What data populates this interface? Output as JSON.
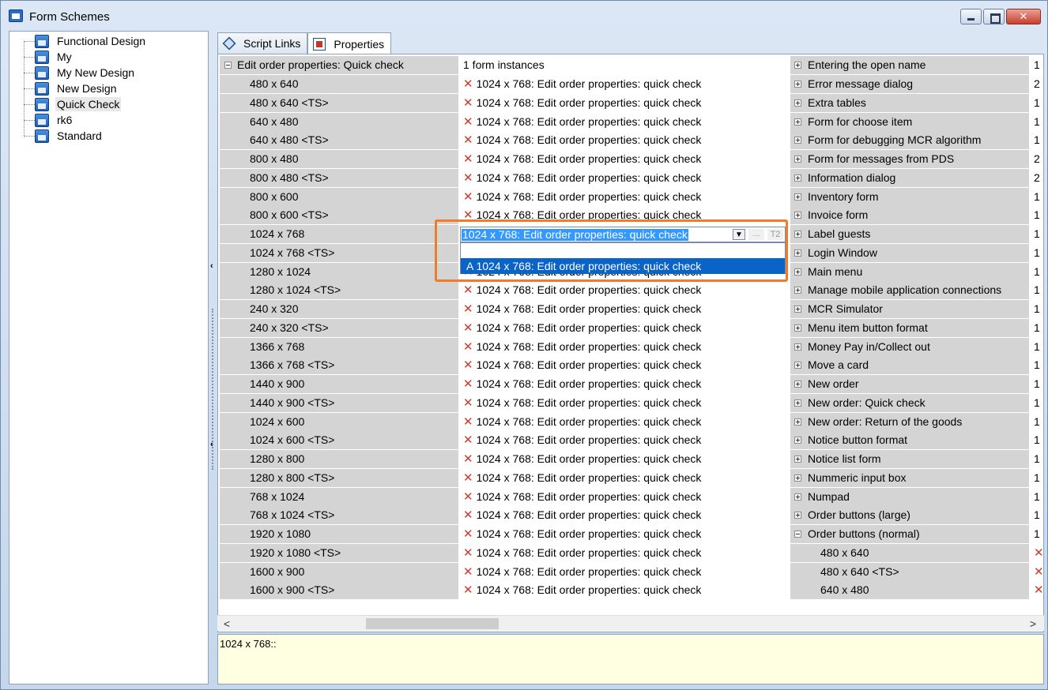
{
  "window": {
    "title": "Form Schemes"
  },
  "tree": {
    "items": [
      {
        "label": "Functional Design",
        "selected": false
      },
      {
        "label": "My",
        "selected": false
      },
      {
        "label": "My New Design",
        "selected": false
      },
      {
        "label": "New Design",
        "selected": false
      },
      {
        "label": "Quick Check",
        "selected": true
      },
      {
        "label": "rk6",
        "selected": false
      },
      {
        "label": "Standard",
        "selected": false
      }
    ]
  },
  "tabs": [
    {
      "label": "Script Links",
      "active": false,
      "icon": "script-links-icon"
    },
    {
      "label": "Properties",
      "active": true,
      "icon": "properties-icon"
    }
  ],
  "grid": {
    "header": {
      "c1": "Edit order properties: Quick check",
      "c2": "1 form instances",
      "c3": "Entering the open name",
      "c4": "1"
    },
    "rows": [
      {
        "c1": "480 x 640",
        "c2": "1024 x 768: Edit order properties: quick check",
        "c3": "Error message dialog",
        "c4": "2"
      },
      {
        "c1": "480 x 640 <TS>",
        "c2": "1024 x 768: Edit order properties: quick check",
        "c3": "Extra tables",
        "c4": "1"
      },
      {
        "c1": "640 x 480",
        "c2": "1024 x 768: Edit order properties: quick check",
        "c3": "Form for choose item",
        "c4": "1"
      },
      {
        "c1": "640 x 480 <TS>",
        "c2": "1024 x 768: Edit order properties: quick check",
        "c3": "Form for debugging MCR algorithm",
        "c4": "1"
      },
      {
        "c1": "800 x 480",
        "c2": "1024 x 768: Edit order properties: quick check",
        "c3": "Form for messages from PDS",
        "c4": "2"
      },
      {
        "c1": "800 x 480 <TS>",
        "c2": "1024 x 768: Edit order properties: quick check",
        "c3": "Information dialog",
        "c4": "2"
      },
      {
        "c1": "800 x 600",
        "c2": "1024 x 768: Edit order properties: quick check",
        "c3": "Inventory form",
        "c4": "1"
      },
      {
        "c1": "800 x 600 <TS>",
        "c2": "1024 x 768: Edit order properties: quick check",
        "c3": "Invoice form",
        "c4": "1"
      },
      {
        "c1": "1024 x 768",
        "c2": "",
        "c3": "Label guests",
        "c4": "1"
      },
      {
        "c1": "1024 x 768 <TS>",
        "c2": "",
        "c3": "Login Window",
        "c4": "1"
      },
      {
        "c1": "1280 x 1024",
        "c2": "1024 x 768: Edit order properties: quick check",
        "c3": "Main menu",
        "c4": "1"
      },
      {
        "c1": "1280 x 1024 <TS>",
        "c2": "1024 x 768: Edit order properties: quick check",
        "c3": "Manage mobile application connections",
        "c4": "1"
      },
      {
        "c1": "240 x 320",
        "c2": "1024 x 768: Edit order properties: quick check",
        "c3": "MCR Simulator",
        "c4": "1"
      },
      {
        "c1": "240 x 320 <TS>",
        "c2": "1024 x 768: Edit order properties: quick check",
        "c3": "Menu item button format",
        "c4": "1"
      },
      {
        "c1": "1366 x 768",
        "c2": "1024 x 768: Edit order properties: quick check",
        "c3": "Money Pay in/Collect out",
        "c4": "1"
      },
      {
        "c1": "1366 x 768 <TS>",
        "c2": "1024 x 768: Edit order properties: quick check",
        "c3": "Move a card",
        "c4": "1"
      },
      {
        "c1": "1440 x 900",
        "c2": "1024 x 768: Edit order properties: quick check",
        "c3": "New order",
        "c4": "1"
      },
      {
        "c1": "1440 x 900 <TS>",
        "c2": "1024 x 768: Edit order properties: quick check",
        "c3": "New order: Quick check",
        "c4": "1"
      },
      {
        "c1": "1024 x 600",
        "c2": "1024 x 768: Edit order properties: quick check",
        "c3": "New order: Return of the goods",
        "c4": "1"
      },
      {
        "c1": "1024 x 600 <TS>",
        "c2": "1024 x 768: Edit order properties: quick check",
        "c3": "Notice button format",
        "c4": "1"
      },
      {
        "c1": "1280 x 800",
        "c2": "1024 x 768: Edit order properties: quick check",
        "c3": "Notice list form",
        "c4": "1"
      },
      {
        "c1": "1280 x 800 <TS>",
        "c2": "1024 x 768: Edit order properties: quick check",
        "c3": "Nummeric input box",
        "c4": "1"
      },
      {
        "c1": "768 x 1024",
        "c2": "1024 x 768: Edit order properties: quick check",
        "c3": "Numpad",
        "c4": "1"
      },
      {
        "c1": "768 x 1024 <TS>",
        "c2": "1024 x 768: Edit order properties: quick check",
        "c3": "Order buttons (large)",
        "c4": "1"
      },
      {
        "c1": "1920 x 1080",
        "c2": "1024 x 768: Edit order properties: quick check",
        "c3": "Order buttons (normal)",
        "c4": "1",
        "c3_expanded": true
      },
      {
        "c1": "1920 x 1080 <TS>",
        "c2": "1024 x 768: Edit order properties: quick check",
        "c3": "480 x 640",
        "c4": "x",
        "c3_sub": true
      },
      {
        "c1": "1600 x 900",
        "c2": "1024 x 768: Edit order properties: quick check",
        "c3": "480 x 640 <TS>",
        "c4": "x",
        "c3_sub": true
      },
      {
        "c1": "1600 x 900 <TS>",
        "c2": "1024 x 768: Edit order properties: quick check",
        "c3": "640 x 480",
        "c4": "x",
        "c3_sub": true
      }
    ]
  },
  "editor": {
    "value": "1024 x 768: Edit order properties: quick check",
    "ellipsis": "...",
    "t2": "T2",
    "dropdown_item": "A  1024 x 768: Edit order properties: quick check"
  },
  "description": {
    "text": "1024 x 768::"
  },
  "colors": {
    "accent": "#f07a2e",
    "selection": "#0a64c8",
    "x_mark": "#d13a2a",
    "desc_bg": "#ffffe1"
  }
}
